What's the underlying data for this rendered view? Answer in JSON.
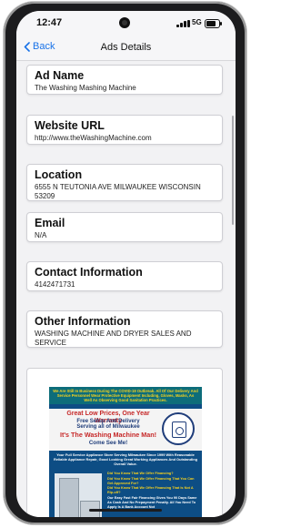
{
  "status_bar": {
    "time": "12:47",
    "network": "5G"
  },
  "nav": {
    "back_label": "Back",
    "title": "Ads Details"
  },
  "fields": [
    {
      "label": "Ad Name",
      "value": "The Washing Mashing Machine"
    },
    {
      "label": "Website URL",
      "value": "http://www.theWashingMachine.com"
    },
    {
      "label": "Location",
      "value": "6555 N TEUTONIA AVE MILWAUKEE WISCONSIN 53209"
    },
    {
      "label": "Email",
      "value": "N/A"
    },
    {
      "label": "Contact Information",
      "value": "4142471731"
    },
    {
      "label": "Other Information",
      "value": "WASHING MACHINE AND DRYER SALES AND SERVICE"
    }
  ],
  "flyer": {
    "top_text": "We Are Still In Business During The COVID-19 Outbreak. All Of Our Delivery And Service Personnel Wear Protective Equipment Including, Gloves, Masks, As Well As Observing Good Sanitation Practices.",
    "line1": "Great Low Prices, One Year Warranty",
    "line2": "Free Setup And Delivery",
    "line3": "Serving all of Milwaukee",
    "line4": "It's The Washing Machine Man!",
    "line5": "Come See Me!",
    "sub_text": "Your Full Service Appliance Store Serving Milwaukee Since 1999 With Reasonable Reliable Appliance Repair, Good Looking Great Working Appliances And Outstanding Overall Value.",
    "faq": [
      "Did You Know That We Offer Financing?",
      "Did You Know That We Offer Financing That You Can Get Approved For?",
      "Did You Know That We Offer Financing That Is Not A Rip-off?",
      "Our Easy Fast Fair Financing Gives You 90 Days Same As Cash And No Prepayment Penalty. All You Need To Apply Is A Bank Account Not"
    ]
  },
  "colors": {
    "accent": "#1a73e8",
    "flyer_blue": "#0d4d84",
    "flyer_yellow": "#f7d21e",
    "flyer_red": "#c62828"
  }
}
